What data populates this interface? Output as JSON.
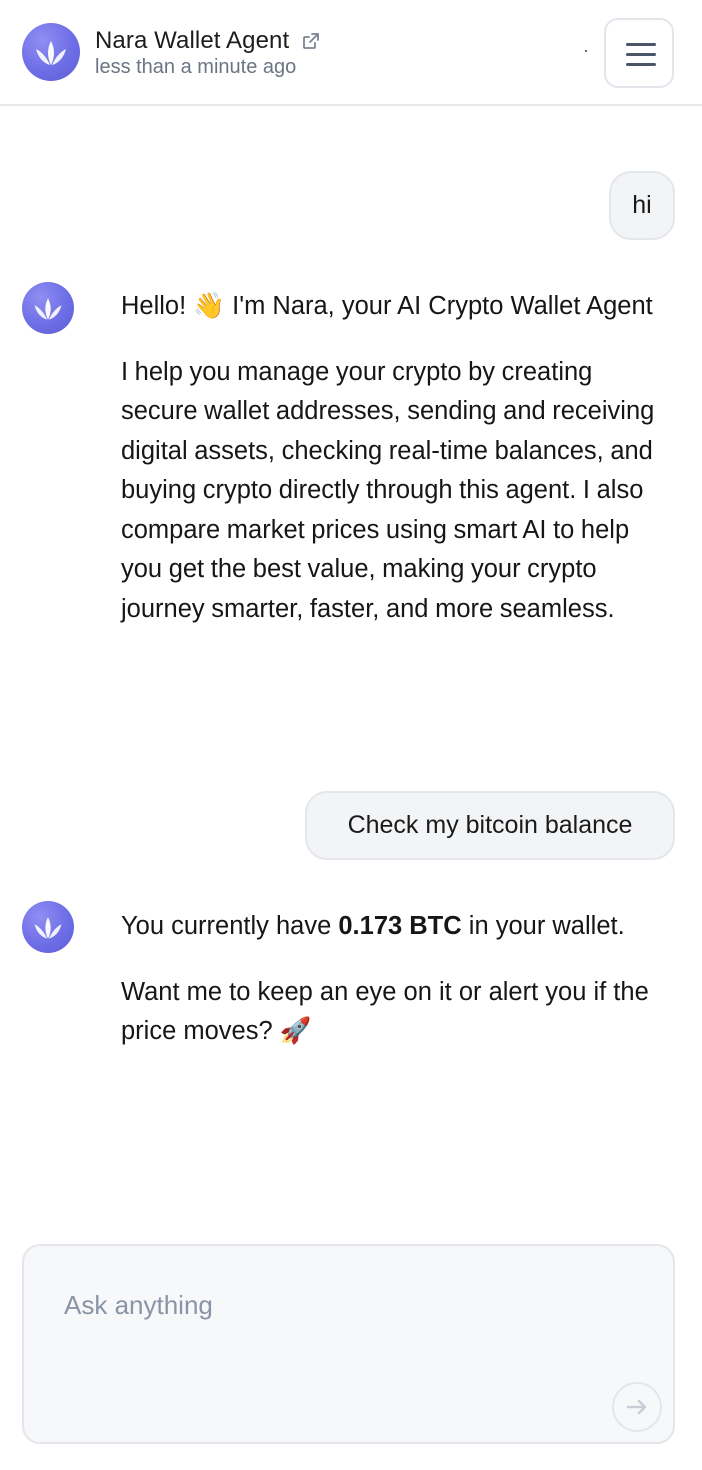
{
  "header": {
    "title": "Nara Wallet Agent",
    "subtitle": "less than a minute ago",
    "icons": {
      "avatar": "lotus-logo",
      "external": "external-link-icon",
      "menu": "hamburger-menu-icon"
    }
  },
  "messages": [
    {
      "role": "user",
      "text": "hi"
    },
    {
      "role": "assistant",
      "p1_prefix": "Hello! ",
      "p1_emoji": "👋",
      "p1_suffix": " I'm Nara, your AI Crypto Wallet Agent",
      "p2": "I help you manage your crypto by creating secure wallet addresses, sending and receiving digital assets, checking real-time balances, and buying crypto directly through this agent. I also compare market prices using smart AI to help you get the best value, making your crypto journey smarter, faster, and more seamless."
    },
    {
      "role": "user",
      "text": "Check my bitcoin balance"
    },
    {
      "role": "assistant",
      "p1_prefix": "You currently have ",
      "p1_bold": "0.173 BTC",
      "p1_suffix": " in your wallet.",
      "p2_text": "Want me to keep an eye on it or alert you if the price moves? ",
      "p2_emoji": "🚀"
    }
  ],
  "composer": {
    "placeholder": "Ask anything",
    "send_icon": "arrow-right-icon"
  },
  "colors": {
    "accent": "#6e6ee6",
    "bubble_bg": "#f3f4f6",
    "border": "#e3e6eb",
    "muted": "#6b7585"
  }
}
